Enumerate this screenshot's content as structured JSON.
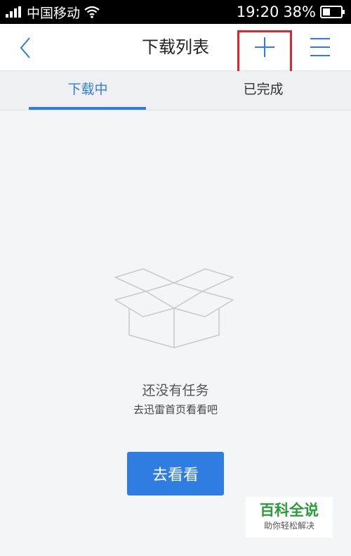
{
  "status_bar": {
    "carrier": "中国移动",
    "time": "19:20",
    "battery": "38%",
    "icons": [
      "signal-icon",
      "wifi-icon",
      "battery-icon"
    ]
  },
  "nav": {
    "title": "下载列表",
    "back_icon": "chevron-left-icon",
    "add_icon": "plus-icon",
    "menu_icon": "menu-icon"
  },
  "tabs": [
    {
      "label": "下载中",
      "active": true
    },
    {
      "label": "已完成",
      "active": false
    }
  ],
  "empty_state": {
    "icon": "empty-box-icon",
    "title": "还没有任务",
    "subtitle": "去迅雷首页看看吧",
    "button_label": "去看看"
  },
  "watermark": {
    "logo_text": "百科全说",
    "slogan": "助你轻松解决"
  },
  "colors": {
    "accent": "#2f7de1",
    "highlight": "#e8232a",
    "watermark_green": "#2a9d3a"
  }
}
